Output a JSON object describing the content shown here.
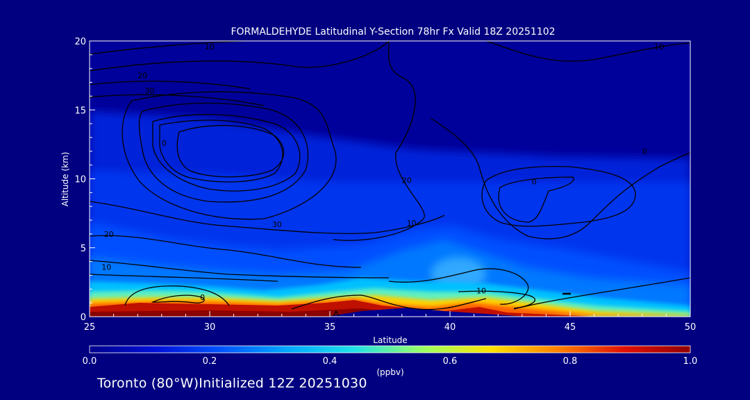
{
  "chart_data": {
    "type": "heatmap",
    "title": "FORMALDEHYDE Latitudinal Y-Section 78hr  Fx Valid 18Z 20251102",
    "xlabel": "Latitude",
    "ylabel": "Altitude (km)",
    "xlim": [
      25,
      50
    ],
    "ylim": [
      0,
      20
    ],
    "xticks": [
      "25",
      "30",
      "35",
      "40",
      "45",
      "50"
    ],
    "yticks": [
      "0",
      "5",
      "10",
      "15",
      "20"
    ],
    "colorbar": {
      "label": "(ppbv)",
      "range": [
        0.0,
        1.0
      ],
      "ticks": [
        "0.0",
        "0.2",
        "0.4",
        "0.6",
        "0.8",
        "1.0"
      ],
      "colors": [
        "#00008c",
        "#0010d8",
        "#0055ff",
        "#00a8ff",
        "#20e0e8",
        "#a0ff60",
        "#ffe000",
        "#ff8000",
        "#e01000",
        "#900000"
      ]
    },
    "background_color": "#000080",
    "contour_labels": [
      {
        "text": "10",
        "lat": 30.0,
        "alt": 19.6
      },
      {
        "text": "20",
        "lat": 27.2,
        "alt": 17.5
      },
      {
        "text": "30",
        "lat": 27.5,
        "alt": 16.4
      },
      {
        "text": "0",
        "lat": 28.1,
        "alt": 12.6
      },
      {
        "text": "30",
        "lat": 32.8,
        "alt": 6.7
      },
      {
        "text": "20",
        "lat": 25.8,
        "alt": 6.0
      },
      {
        "text": "10",
        "lat": 25.7,
        "alt": 3.6
      },
      {
        "text": "0",
        "lat": 29.7,
        "alt": 1.4
      },
      {
        "text": "20",
        "lat": 38.2,
        "alt": 9.9
      },
      {
        "text": "10",
        "lat": 38.4,
        "alt": 6.8
      },
      {
        "text": "10",
        "lat": 41.3,
        "alt": 1.9
      },
      {
        "text": "0",
        "lat": 43.5,
        "alt": 9.8
      },
      {
        "text": "0",
        "lat": 48.1,
        "alt": 12.0
      },
      {
        "text": "10",
        "lat": 48.7,
        "alt": 19.6
      }
    ]
  },
  "footer": {
    "text": "Toronto (80°W)Initialized 12Z 20251030"
  }
}
